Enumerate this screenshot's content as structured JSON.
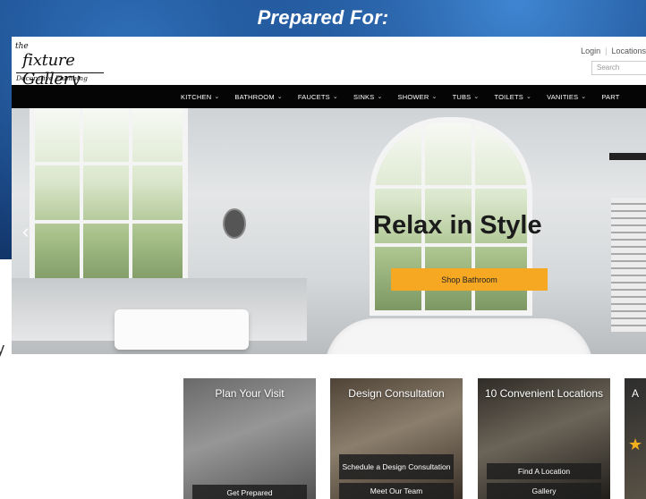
{
  "banner": {
    "text": "Prepared For:"
  },
  "header": {
    "logo": {
      "the": "the",
      "name": "fixture Gallery",
      "tagline": "Decorative Plumbing"
    },
    "links": [
      "Login",
      "Locations"
    ],
    "search_placeholder": "Search"
  },
  "nav": {
    "items": [
      "KITCHEN",
      "BATHROOM",
      "FAUCETS",
      "SINKS",
      "SHOWER",
      "TUBS",
      "TOILETS",
      "VANITIES",
      "PART"
    ]
  },
  "hero": {
    "headline": "Relax in Style",
    "cta": "Shop Bathroom",
    "prev_arrow": "‹"
  },
  "cards": [
    {
      "title": "Plan Your Visit",
      "buttons": [
        "Get Prepared"
      ]
    },
    {
      "title": "Design Consultation",
      "buttons": [
        "Schedule a Design Consultation",
        "Meet Our Team"
      ]
    },
    {
      "title": "10 Convenient Locations",
      "buttons": [
        "Find A Location",
        "Gallery"
      ]
    },
    {
      "title": "A",
      "buttons": []
    }
  ],
  "left_fragment": "y",
  "colors": {
    "cta": "#f7a823",
    "nav_bg": "#050505",
    "banner_bg": "#0d2f66"
  }
}
